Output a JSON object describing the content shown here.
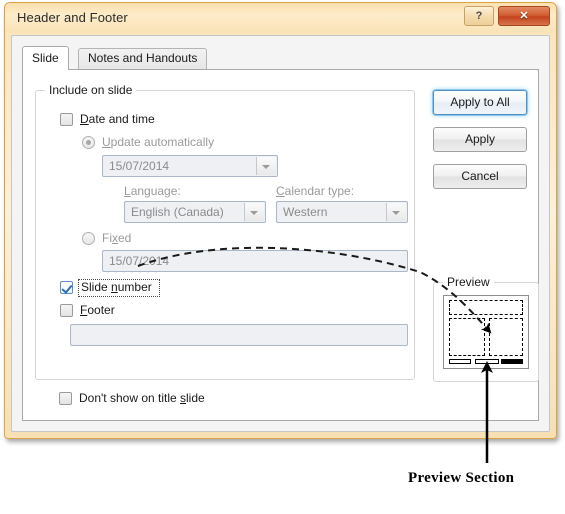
{
  "window": {
    "title": "Header and Footer",
    "help_button": "?",
    "close_button": "✕"
  },
  "tabs": [
    {
      "label": "Slide",
      "active": true
    },
    {
      "label": "Notes and Handouts",
      "active": false
    }
  ],
  "groups": {
    "include_on_slide": "Include on slide",
    "preview": "Preview"
  },
  "fields": {
    "date_and_time": {
      "label": "Date and time",
      "checked": false,
      "mnemonic": "D"
    },
    "update_automatically": {
      "label": "Update automatically",
      "selected": true,
      "disabled": true
    },
    "date_dropdown": {
      "value": "15/07/2014"
    },
    "language": {
      "label": "Language:",
      "value": "English (Canada)"
    },
    "calendar_type": {
      "label": "Calendar type:",
      "value": "Western"
    },
    "fixed": {
      "label": "Fixed",
      "selected": false,
      "disabled": true
    },
    "fixed_date": {
      "value": "15/07/2014"
    },
    "slide_number": {
      "label": "Slide number",
      "checked": true,
      "focused": true
    },
    "footer": {
      "label": "Footer",
      "checked": false
    },
    "footer_text": {
      "value": "",
      "placeholder": ""
    },
    "dont_show_on_title_slide": {
      "label": "Don't show on title slide",
      "checked": false
    }
  },
  "buttons": {
    "apply_to_all": "Apply to All",
    "apply": "Apply",
    "cancel": "Cancel"
  },
  "preview_thumbnail": {
    "placeholders": [
      "title-placeholder",
      "content-left-placeholder",
      "content-right-placeholder"
    ],
    "footer_bars": [
      {
        "name": "date-bar",
        "filled": false
      },
      {
        "name": "footer-bar",
        "filled": false
      },
      {
        "name": "slide-number-bar",
        "filled": true
      }
    ]
  },
  "annotations": {
    "preview_section_label": "Preview Section"
  },
  "colors": {
    "title_bar": "#fbe3b8",
    "window_border": "#d9a441",
    "close_button": "#c4431d",
    "default_button_glow": "#8fc9ee",
    "checkbox_check": "#2d6db5",
    "annotation": "#000000"
  }
}
